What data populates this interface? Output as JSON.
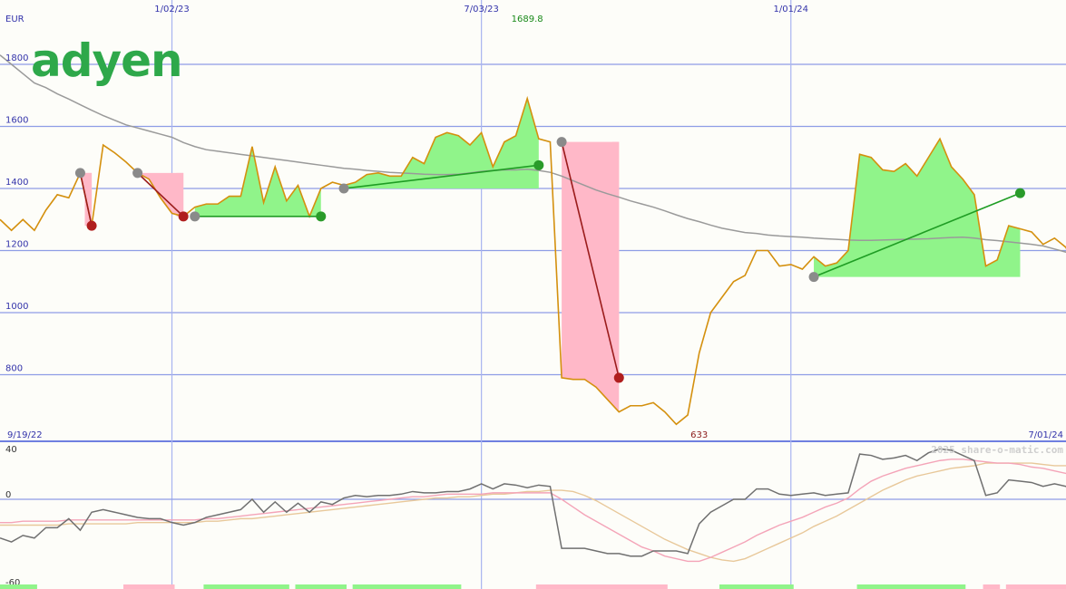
{
  "brand": {
    "logo_text": "adyen",
    "logo_color": "#2ea84a"
  },
  "watermark": "2025 share-o-matic.com",
  "currency": "EUR",
  "colors": {
    "price": "#d4900e",
    "ma_long": "#9a9a9a",
    "grid": "#8e9de6",
    "vline": "#a8b4f0",
    "gain_fill": "#90f48a",
    "loss_fill": "#ffb8c8",
    "buy_line": "#1f9d24",
    "sell_line": "#9b1c1c",
    "buy_dot": "#2a9b2a",
    "sell_dot": "#b01e1e",
    "entry_dot": "#8a8a8a",
    "osc": "#707070",
    "osc_pink": "#f4a4b8",
    "osc_tan": "#e8c89a"
  },
  "chart_data": [
    {
      "type": "line",
      "title": "",
      "ylabel": "EUR",
      "ylim": [
        520,
        1870
      ],
      "yticks": [
        800,
        1000,
        1200,
        1400,
        1600,
        1800
      ],
      "x_axis": {
        "start_label": "9/19/22",
        "end_label": "7/01/24",
        "n_points": 94
      },
      "date_markers": [
        {
          "label": "1/02/23",
          "index": 15
        },
        {
          "label": "7/03/23",
          "index": 42
        },
        {
          "label": "1/01/24",
          "index": 69
        }
      ],
      "annotations": [
        {
          "text": "1689.8",
          "index": 46,
          "kind": "high"
        },
        {
          "text": "633",
          "index": 61,
          "kind": "low"
        }
      ],
      "series": [
        {
          "role": "price",
          "values": [
            1300,
            1265,
            1300,
            1265,
            1330,
            1380,
            1370,
            1450,
            1280,
            1540,
            1515,
            1485,
            1450,
            1430,
            1370,
            1320,
            1310,
            1340,
            1350,
            1350,
            1375,
            1375,
            1535,
            1355,
            1470,
            1360,
            1410,
            1310,
            1400,
            1420,
            1410,
            1420,
            1445,
            1450,
            1440,
            1440,
            1500,
            1480,
            1565,
            1580,
            1570,
            1540,
            1580,
            1470,
            1550,
            1570,
            1690,
            1560,
            1550,
            790,
            785,
            785,
            760,
            720,
            680,
            700,
            700,
            710,
            680,
            640,
            670,
            870,
            1000,
            1050,
            1100,
            1120,
            1200,
            1200,
            1150,
            1155,
            1140,
            1180,
            1150,
            1160,
            1200,
            1510,
            1500,
            1460,
            1455,
            1480,
            1440,
            1500,
            1560,
            1470,
            1430,
            1380,
            1150,
            1170,
            1280,
            1270,
            1260,
            1220,
            1240,
            1210,
            1115
          ]
        },
        {
          "role": "long moving average",
          "values": [
            1830,
            1800,
            1770,
            1740,
            1725,
            1705,
            1688,
            1670,
            1652,
            1635,
            1620,
            1605,
            1595,
            1585,
            1575,
            1565,
            1548,
            1535,
            1525,
            1520,
            1515,
            1510,
            1505,
            1500,
            1495,
            1490,
            1485,
            1480,
            1475,
            1470,
            1465,
            1462,
            1458,
            1455,
            1452,
            1450,
            1448,
            1446,
            1445,
            1445,
            1446,
            1450,
            1455,
            1458,
            1460,
            1460,
            1462,
            1458,
            1452,
            1440,
            1425,
            1410,
            1395,
            1383,
            1372,
            1360,
            1350,
            1340,
            1328,
            1315,
            1303,
            1293,
            1282,
            1272,
            1265,
            1258,
            1255,
            1250,
            1247,
            1245,
            1243,
            1240,
            1238,
            1236,
            1234,
            1233,
            1233,
            1234,
            1235,
            1236,
            1237,
            1238,
            1240,
            1242,
            1243,
            1240,
            1235,
            1232,
            1228,
            1224,
            1220,
            1215,
            1205,
            1195,
            1187
          ]
        }
      ],
      "trades": [
        {
          "entry_index": 7,
          "entry": 1450,
          "exit_index": 8,
          "exit": 1280,
          "result": "loss"
        },
        {
          "entry_index": 12,
          "entry": 1450,
          "exit_index": 16,
          "exit": 1310,
          "result": "loss"
        },
        {
          "entry_index": 17,
          "entry": 1310,
          "exit_index": 28,
          "exit": 1310,
          "result": "gain"
        },
        {
          "entry_index": 30,
          "entry": 1400,
          "exit_index": 47,
          "exit": 1475,
          "result": "gain"
        },
        {
          "entry_index": 49,
          "entry": 1550,
          "exit_index": 54,
          "exit": 790,
          "result": "loss"
        },
        {
          "entry_index": 71,
          "entry": 1115,
          "exit_index": 89,
          "exit": 1385,
          "result": "gain"
        }
      ]
    },
    {
      "type": "line",
      "title": "",
      "ylim": [
        -60,
        43
      ],
      "yticks": [
        40,
        0,
        -60
      ],
      "series": [
        {
          "role": "oscillator",
          "values": [
            -30,
            -33,
            -28,
            -30,
            -22,
            -22,
            -15,
            -24,
            -10,
            -8,
            -10,
            -12,
            -14,
            -15,
            -15,
            -18,
            -20,
            -18,
            -14,
            -12,
            -10,
            -8,
            0,
            -10,
            -2,
            -10,
            -3,
            -10,
            -2,
            -4,
            1,
            3,
            2,
            3,
            3,
            4,
            6,
            5,
            5,
            6,
            6,
            8,
            12,
            8,
            12,
            11,
            9,
            11,
            10,
            -38,
            -38,
            -38,
            -40,
            -42,
            -42,
            -44,
            -44,
            -40,
            -40,
            -40,
            -42,
            -19,
            -10,
            -5,
            0,
            0,
            8,
            8,
            4,
            3,
            4,
            5,
            3,
            4,
            5,
            35,
            34,
            31,
            32,
            34,
            30,
            36,
            39,
            38,
            34,
            30,
            3,
            5,
            15,
            14,
            13,
            10,
            12,
            10,
            0
          ]
        },
        {
          "role": "signal pink",
          "values": [
            -18,
            -18,
            -17,
            -17,
            -17,
            -17,
            -16,
            -16,
            -16,
            -16,
            -16,
            -16,
            -16,
            -16,
            -16,
            -16,
            -16,
            -16,
            -15,
            -15,
            -14,
            -13,
            -12,
            -11,
            -10,
            -9,
            -8,
            -7,
            -6,
            -5,
            -4,
            -3,
            -2,
            -1,
            0,
            1,
            2,
            2,
            3,
            4,
            4,
            4,
            4,
            5,
            5,
            5,
            5,
            5,
            5,
            0,
            -6,
            -12,
            -17,
            -22,
            -27,
            -32,
            -37,
            -40,
            -44,
            -46,
            -48,
            -48,
            -45,
            -41,
            -37,
            -33,
            -28,
            -24,
            -20,
            -17,
            -14,
            -10,
            -6,
            -3,
            1,
            8,
            14,
            18,
            21,
            24,
            26,
            28,
            30,
            31,
            31,
            30,
            29,
            28,
            28,
            27,
            25,
            24,
            22,
            20,
            18
          ]
        },
        {
          "role": "signal tan",
          "values": [
            -20,
            -20,
            -20,
            -20,
            -20,
            -20,
            -19,
            -19,
            -19,
            -19,
            -19,
            -19,
            -18,
            -18,
            -18,
            -18,
            -18,
            -18,
            -17,
            -17,
            -16,
            -15,
            -15,
            -14,
            -13,
            -12,
            -11,
            -10,
            -9,
            -8,
            -7,
            -6,
            -5,
            -4,
            -3,
            -2,
            -1,
            0,
            1,
            1,
            2,
            2,
            3,
            4,
            4,
            5,
            6,
            6,
            7,
            7,
            6,
            3,
            -1,
            -6,
            -11,
            -16,
            -21,
            -26,
            -31,
            -35,
            -39,
            -42,
            -45,
            -47,
            -48,
            -46,
            -42,
            -38,
            -34,
            -30,
            -26,
            -21,
            -17,
            -13,
            -8,
            -3,
            2,
            7,
            11,
            15,
            18,
            20,
            22,
            24,
            25,
            26,
            28,
            28,
            28,
            28,
            28,
            27,
            26,
            26,
            25
          ]
        }
      ],
      "bars": [
        {
          "from": 0,
          "to": 3,
          "result": "gain"
        },
        {
          "from": 11,
          "to": 15,
          "result": "loss"
        },
        {
          "from": 18,
          "to": 25,
          "result": "gain"
        },
        {
          "from": 26,
          "to": 30,
          "result": "gain"
        },
        {
          "from": 31,
          "to": 40,
          "result": "gain"
        },
        {
          "from": 47,
          "to": 58,
          "result": "loss"
        },
        {
          "from": 63,
          "to": 69,
          "result": "gain"
        },
        {
          "from": 75,
          "to": 84,
          "result": "gain"
        },
        {
          "from": 86,
          "to": 87,
          "result": "loss"
        },
        {
          "from": 88,
          "to": 93,
          "result": "loss"
        }
      ]
    }
  ]
}
